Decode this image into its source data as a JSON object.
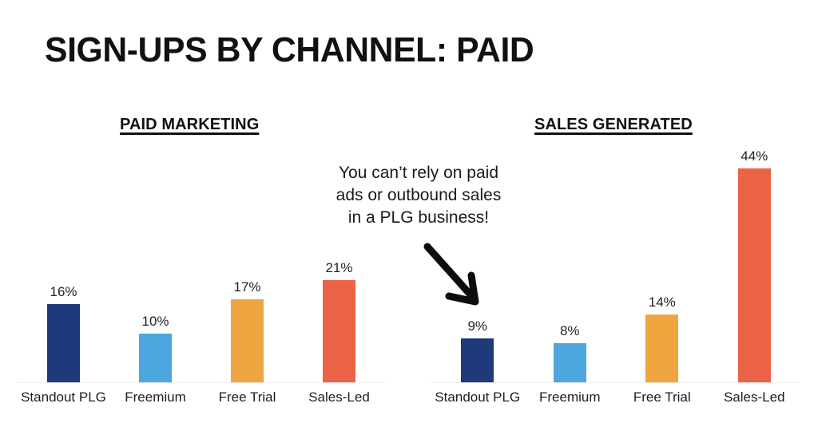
{
  "title": "SIGN-UPS BY CHANNEL: PAID",
  "panels": {
    "left": {
      "header": "PAID MARKETING"
    },
    "right": {
      "header": "SALES GENERATED"
    }
  },
  "annotation": {
    "line1": "You can’t rely on paid",
    "line2": "ads or outbound sales",
    "line3": "in a PLG business!",
    "arrow": "curved-arrow-down-right-icon"
  },
  "colors": {
    "standout_plg": "#1e3a7b",
    "freemium": "#4da6dd",
    "free_trial": "#efa540",
    "sales_led": "#eb6347",
    "baseline": "#eceded",
    "text": "#1a1a1a"
  },
  "chart_data": [
    {
      "type": "bar",
      "title": "PAID MARKETING",
      "xlabel": "",
      "ylabel": "",
      "ylim": [
        0,
        48
      ],
      "grid": false,
      "legend": "none",
      "value_suffix": "%",
      "categories": [
        "Standout PLG",
        "Freemium",
        "Free Trial",
        "Sales-Led"
      ],
      "values": [
        16,
        10,
        17,
        21
      ],
      "value_labels": [
        "16%",
        "10%",
        "17%",
        "21%"
      ],
      "colors": [
        "#1e3a7b",
        "#4da6dd",
        "#efa540",
        "#eb6347"
      ]
    },
    {
      "type": "bar",
      "title": "SALES GENERATED",
      "xlabel": "",
      "ylabel": "",
      "ylim": [
        0,
        48
      ],
      "grid": false,
      "legend": "none",
      "value_suffix": "%",
      "categories": [
        "Standout PLG",
        "Freemium",
        "Free Trial",
        "Sales-Led"
      ],
      "values": [
        9,
        8,
        14,
        44
      ],
      "value_labels": [
        "9%",
        "8%",
        "14%",
        "44%"
      ],
      "colors": [
        "#1e3a7b",
        "#4da6dd",
        "#efa540",
        "#eb6347"
      ]
    }
  ]
}
